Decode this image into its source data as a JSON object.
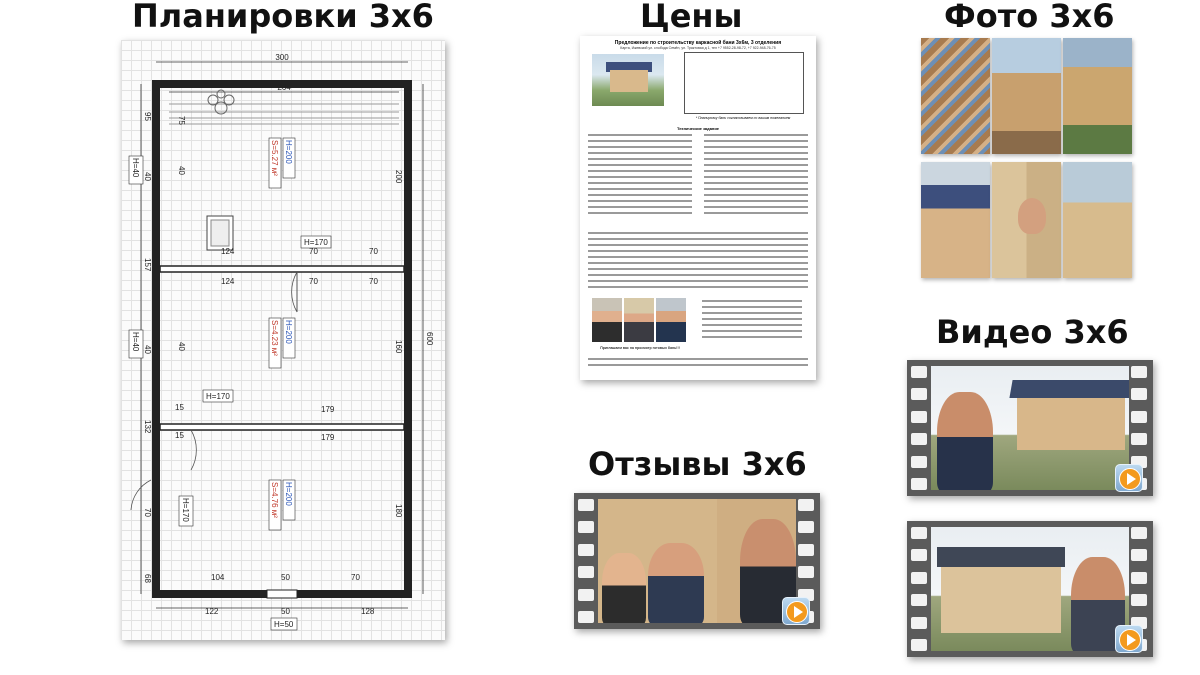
{
  "headings": {
    "plans": "Планировки 3х6",
    "prices": "Цены",
    "photos": "Фото 3х6",
    "video": "Видео 3х6",
    "reviews": "Отзывы 3х6"
  },
  "plan": {
    "dims": {
      "top_outer": "300",
      "top_inner": "264",
      "right_total": "600",
      "left_95": "95",
      "left_40a": "40",
      "left_157": "157",
      "left_40b": "40",
      "left_132": "132",
      "left_15": "15",
      "left_70": "70",
      "left_68": "68",
      "r_75": "75",
      "r_200": "200",
      "r_40a": "40",
      "r_40b": "40",
      "r_160": "160",
      "r_180": "180",
      "mid_124a": "124",
      "mid_70a": "70",
      "mid_70b": "70",
      "mid_124b": "124",
      "mid_70c": "70",
      "mid_70d": "70",
      "mid_179a": "179",
      "mid_179b": "179",
      "mid_15": "15",
      "bot_104": "104",
      "bot_50a": "50",
      "bot_70": "70",
      "bot_122": "122",
      "bot_50b": "50",
      "bot_128": "128"
    },
    "labels": {
      "h40a": "H=40",
      "h40b": "H=40",
      "h170a": "H=170",
      "h170b": "H=170",
      "h170c": "H=170",
      "h50": "H=50"
    },
    "rooms": [
      {
        "area": "S=5.27 м²",
        "height": "H=200"
      },
      {
        "area": "S=4.23 м²",
        "height": "H=200"
      },
      {
        "area": "S=4.76 м²",
        "height": "H=200"
      }
    ]
  },
  "price_doc": {
    "title": "Предложение по строительству каркасной бани 3х6м, 3 отделения",
    "subtitle": "Карта, Ижевский ул. слобода Семён, ул. Трактовая д 1, тел +7 9552-28-98-72, +7 922-948-76-75",
    "caption": "* Планировку бани согласовываем со вашим пожеланием",
    "section": "Технические задание",
    "closing": "Приглашаем вас на просмотр готовых бань!!!"
  },
  "colors": {
    "area_red": "#c0392b",
    "height_blue": "#2a55b8",
    "play_orange": "#f39a1e",
    "film_gray": "#5b5b5b"
  }
}
